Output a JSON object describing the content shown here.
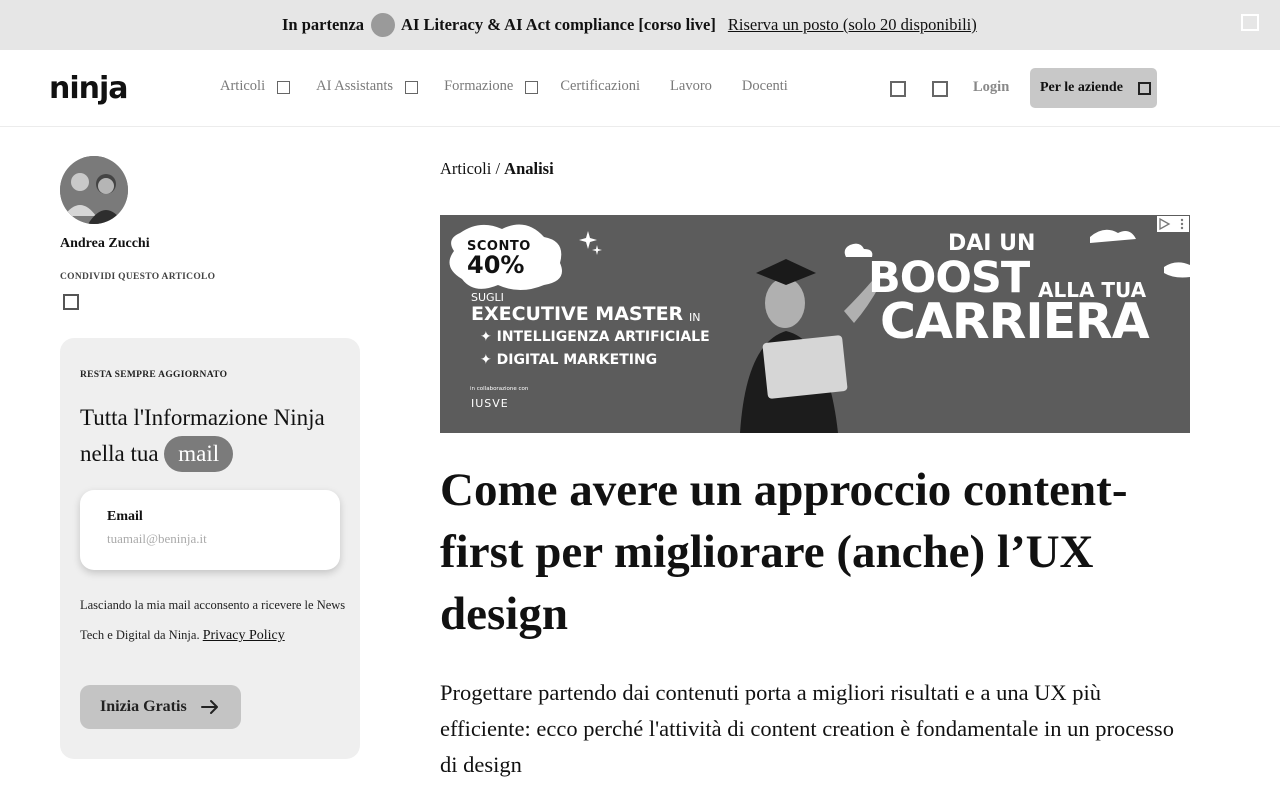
{
  "topbar": {
    "label": "In partenza",
    "course": "AI Literacy & AI Act compliance [corso live]",
    "link": "Riserva un posto (solo 20 disponibili)"
  },
  "header": {
    "logo_text": "ninja",
    "nav": [
      {
        "label": "Articoli",
        "has_dropdown": true
      },
      {
        "label": "AI Assistants",
        "has_dropdown": true
      },
      {
        "label": "Formazione",
        "has_dropdown": true
      },
      {
        "label": "Certificazioni",
        "has_dropdown": false
      },
      {
        "label": "Lavoro",
        "has_dropdown": false
      },
      {
        "label": "Docenti",
        "has_dropdown": false
      }
    ],
    "login": "Login",
    "business_button": "Per le aziende"
  },
  "sidebar": {
    "author": "Andrea Zucchi",
    "share_label": "CONDIVIDI QUESTO ARTICOLO",
    "newsletter": {
      "kicker": "RESTA SEMPRE AGGIORNATO",
      "title": "Tutta l'Informazione Ninja nella tua",
      "pill": "mail",
      "email_label": "Email",
      "email_placeholder": "tuamail@beninja.it",
      "consent": "Lasciando la mia mail acconsento a ricevere le News Tech e Digital da Ninja.",
      "privacy_link": "Privacy Policy",
      "cta": "Inizia Gratis"
    }
  },
  "article": {
    "breadcrumb_parent": "Articoli",
    "breadcrumb_sep": " / ",
    "breadcrumb_current": "Analisi",
    "ad": {
      "sconto": "SCONTO",
      "percent": "40%",
      "sugli": "SUGLI",
      "executive": "EXECUTIVE MASTER",
      "in": "IN",
      "line1": "INTELLIGENZA ARTIFICIALE",
      "line2": "DIGITAL MARKETING",
      "collab": "in collaborazione con",
      "partner": "IUSVE",
      "dai": "DAI UN",
      "boost": "BOOST",
      "alla": "ALLA TUA",
      "carriera": "CARRIERA"
    },
    "title": "Come avere un approccio content-first per migliorare (anche) l’UX design",
    "lede": "Progettare partendo dai contenuti porta a migliori risultati e a una UX più efficiente: ecco perché l'attività di content creation è fondamentale in un processo di design"
  },
  "colors": {
    "topbar_bg": "#e6e6e6",
    "newsletter_bg": "#efefef",
    "pill_bg": "#7b7b7b",
    "button_bg": "#c8c8c8",
    "ad_bg": "#5c5c5c"
  }
}
